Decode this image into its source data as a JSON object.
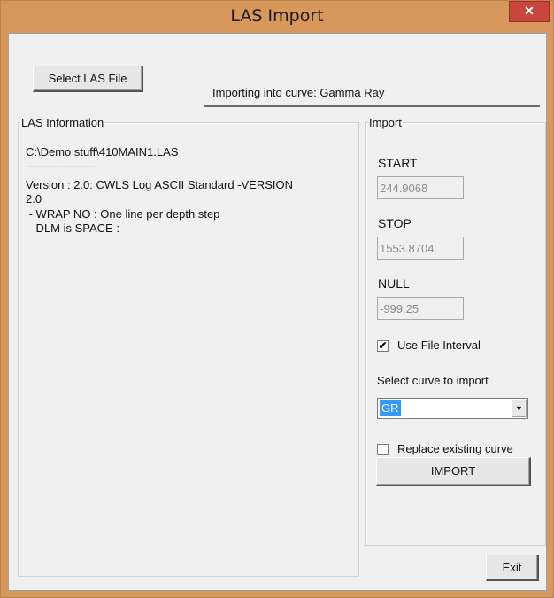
{
  "window": {
    "title": "LAS Import",
    "close_glyph": "✕"
  },
  "toolbar": {
    "select_file_label": "Select LAS File",
    "curve_status": "Importing into curve: Gamma Ray"
  },
  "las_info": {
    "legend": "LAS Information",
    "file_path": "C:\\Demo stuff\\410MAIN1.LAS",
    "separator": "-------------------------------",
    "version_line1": "Version : 2.0: CWLS Log ASCII Standard -VERSION",
    "version_line2": "2.0",
    "wrap_line": " - WRAP NO : One line per depth step",
    "dlm_line": " - DLM is SPACE :"
  },
  "import": {
    "legend": "Import",
    "start_label": "START",
    "start_value": "244.9068",
    "stop_label": "STOP",
    "stop_value": "1553.8704",
    "null_label": "NULL",
    "null_value": "-999.25",
    "use_interval_label": "Use File Interval",
    "use_interval_checked": true,
    "select_curve_label": "Select curve to import",
    "selected_curve": "GR",
    "replace_label": "Replace existing curve",
    "replace_checked": false,
    "import_button": "IMPORT"
  },
  "footer": {
    "exit_button": "Exit"
  },
  "icons": {
    "check_glyph": "✔",
    "dropdown_glyph": "▼"
  },
  "colors": {
    "title_bar": "#d8985c",
    "close_button": "#c9463d",
    "selection": "#3399ff"
  }
}
